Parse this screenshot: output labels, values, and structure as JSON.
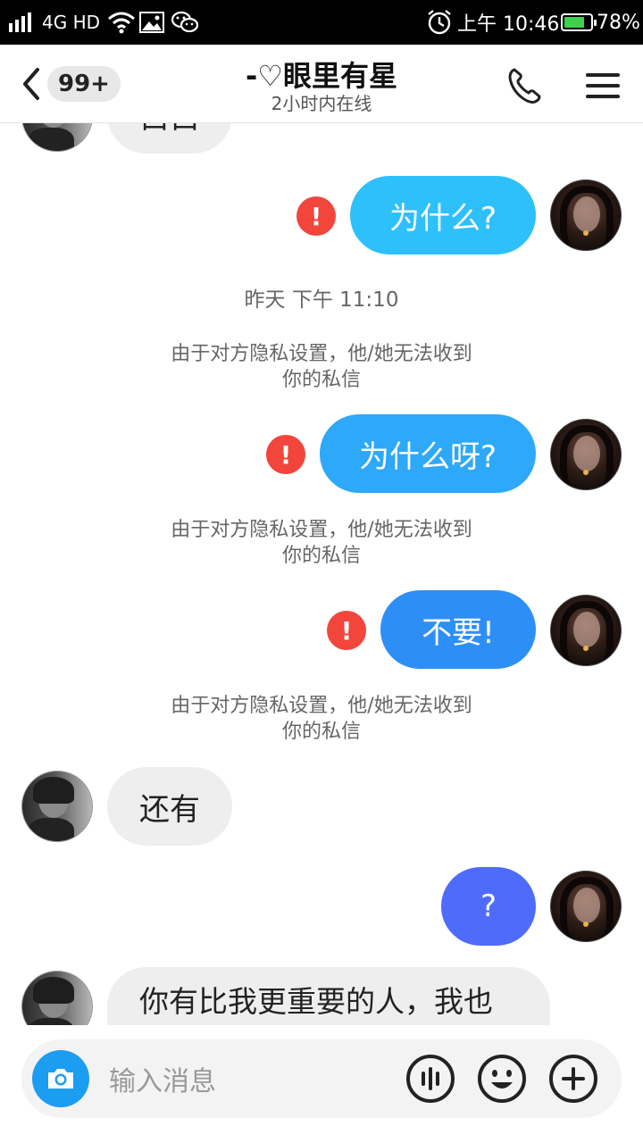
{
  "status_bar": {
    "network": "4G HD",
    "time": "上午 10:46",
    "battery_pct": "78%",
    "battery_level": 0.78
  },
  "header": {
    "unread_badge": "99+",
    "title": "-♡眼里有星",
    "subtitle": "2小时内在线",
    "icons": [
      "back-icon",
      "phone-icon",
      "menu-icon"
    ]
  },
  "messages": [
    {
      "type": "incoming",
      "text": "白白"
    },
    {
      "type": "outgoing",
      "text": "为什么?",
      "failed": true,
      "color": "#2ec0fb"
    },
    {
      "type": "timestamp",
      "text": "昨天 下午 11:10"
    },
    {
      "type": "system",
      "text": "由于对方隐私设置，他/她无法收到你的私信"
    },
    {
      "type": "outgoing",
      "text": "为什么呀?",
      "failed": true,
      "color": "#2ea8f8"
    },
    {
      "type": "system",
      "text": "由于对方隐私设置，他/她无法收到你的私信"
    },
    {
      "type": "outgoing",
      "text": "不要!",
      "failed": true,
      "color": "#2d8ff6"
    },
    {
      "type": "system",
      "text": "由于对方隐私设置，他/她无法收到你的私信"
    },
    {
      "type": "incoming",
      "text": "还有"
    },
    {
      "type": "outgoing",
      "text": "?",
      "color": "#4f6bfb"
    },
    {
      "type": "incoming",
      "text": "你有比我更重要的人，我也有比你更重要的人"
    }
  ],
  "sys_lines": [
    "由于对方隐私设置，他/她无法收到",
    "你的私信"
  ],
  "error_mark": "!",
  "input": {
    "placeholder": "输入消息",
    "icons": [
      "camera-icon",
      "voice-icon",
      "emoji-icon",
      "plus-icon"
    ]
  }
}
